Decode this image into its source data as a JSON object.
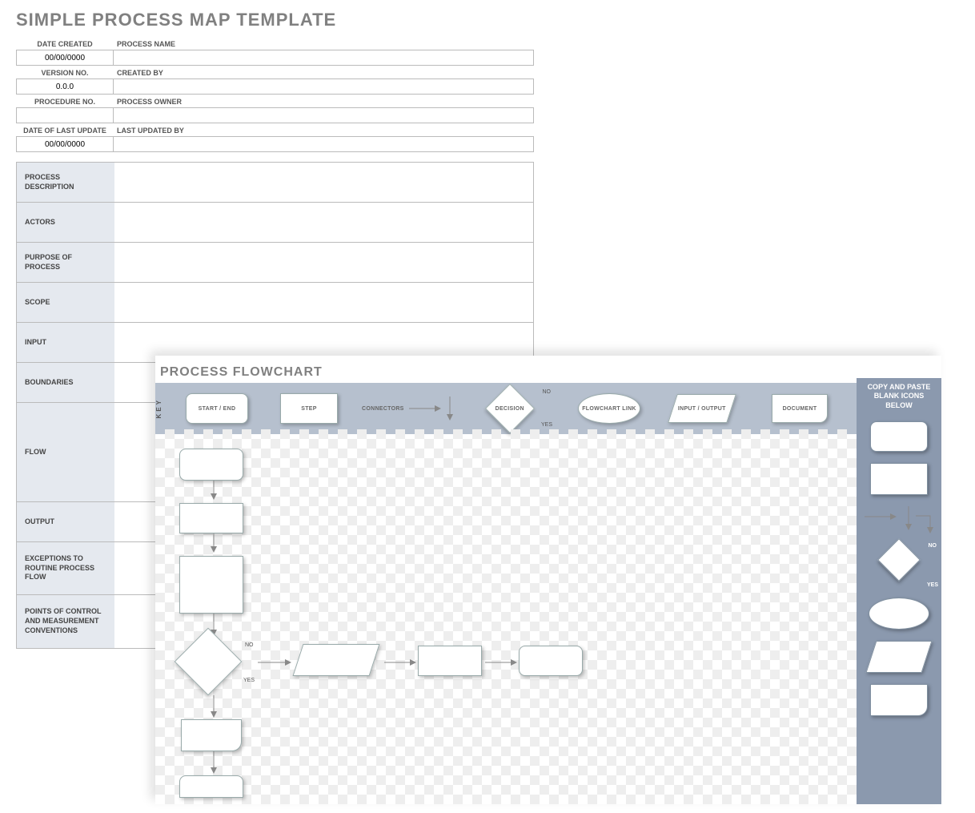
{
  "title": "SIMPLE PROCESS MAP TEMPLATE",
  "meta": {
    "date_created": {
      "label": "DATE CREATED",
      "value": "00/00/0000"
    },
    "process_name": {
      "label": "PROCESS NAME",
      "value": ""
    },
    "version": {
      "label": "VERSION NO.",
      "value": "0.0.0"
    },
    "created_by": {
      "label": "CREATED BY",
      "value": ""
    },
    "procedure_no": {
      "label": "PROCEDURE NO.",
      "value": ""
    },
    "process_owner": {
      "label": "PROCESS OWNER",
      "value": ""
    },
    "last_update": {
      "label": "DATE OF LAST UPDATE",
      "value": "00/00/0000"
    },
    "updated_by": {
      "label": "LAST UPDATED BY",
      "value": ""
    }
  },
  "desc": {
    "process_desc": "PROCESS DESCRIPTION",
    "actors": "ACTORS",
    "purpose": "PURPOSE OF PROCESS",
    "scope": "SCOPE",
    "input": "INPUT",
    "boundaries": "BOUNDARIES",
    "flow": "FLOW",
    "output": "OUTPUT",
    "exceptions": "EXCEPTIONS TO ROUTINE PROCESS FLOW",
    "points": "POINTS OF CONTROL AND MEASUREMENT CONVENTIONS"
  },
  "flowchart": {
    "heading": "PROCESS FLOWCHART",
    "key_label": "KEY",
    "legend": {
      "start_end": "START / END",
      "step": "STEP",
      "connectors": "CONNECTORS",
      "decision": "DECISION",
      "link": "FLOWCHART LINK",
      "io": "INPUT / OUTPUT",
      "document": "DOCUMENT"
    },
    "yes": "YES",
    "no": "NO",
    "sidebar_title": "COPY AND PASTE BLANK ICONS BELOW"
  }
}
